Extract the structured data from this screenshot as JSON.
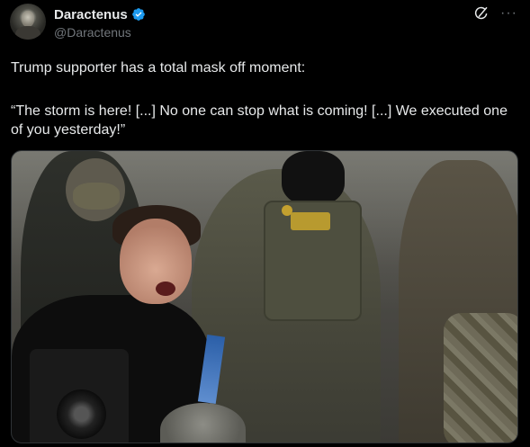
{
  "post": {
    "author": {
      "display_name": "Daractenus",
      "handle": "@Daractenus",
      "verified": true
    },
    "text_line1": "Trump supporter has a total mask off moment:",
    "text_quote": "“The storm is here! [...] No one can stop what is coming! [...] We executed one of you yesterday!”",
    "actions": {
      "grok_icon": "grok-icon",
      "more_label": "···"
    }
  },
  "colors": {
    "background": "#000000",
    "text": "#e7e9ea",
    "secondary_text": "#71767b",
    "verified_badge": "#1d9bf0",
    "border": "#2f3336"
  }
}
